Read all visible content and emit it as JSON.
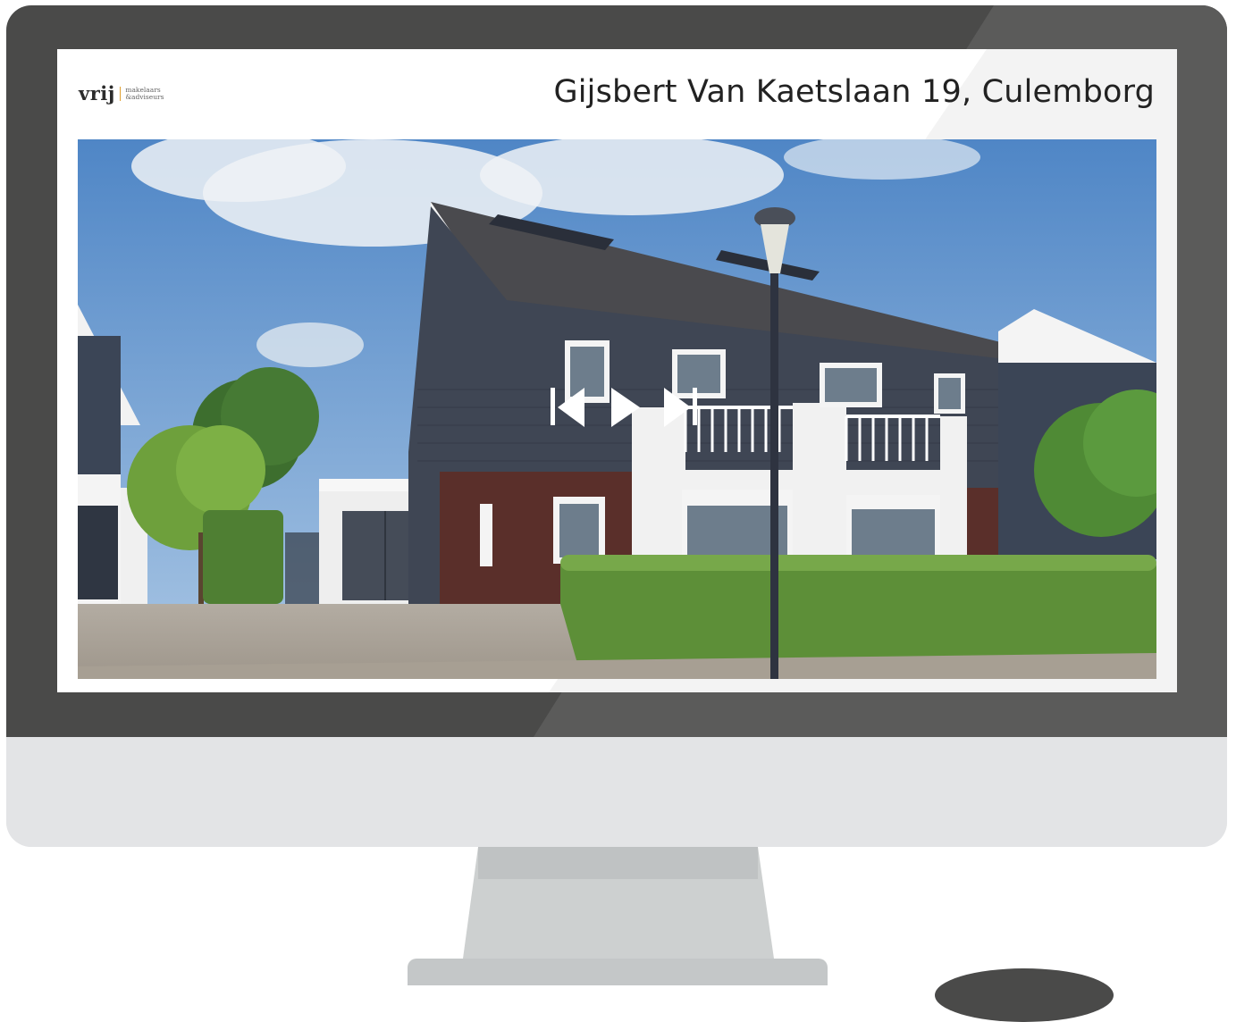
{
  "screen": {
    "logo": {
      "word": "vrij",
      "sub_line1": "makelaars",
      "sub_line2": "&adviseurs"
    },
    "title": "Gijsbert Van Kaetslaan 19, Culemborg"
  },
  "slideshow": {
    "controls": [
      {
        "icon": "skip-back-icon"
      },
      {
        "icon": "play-icon"
      },
      {
        "icon": "skip-forward-icon"
      }
    ]
  },
  "colors": {
    "bezel": "#4a4a49",
    "chin": "#e3e4e6",
    "logo_accent": "#e0a030"
  }
}
